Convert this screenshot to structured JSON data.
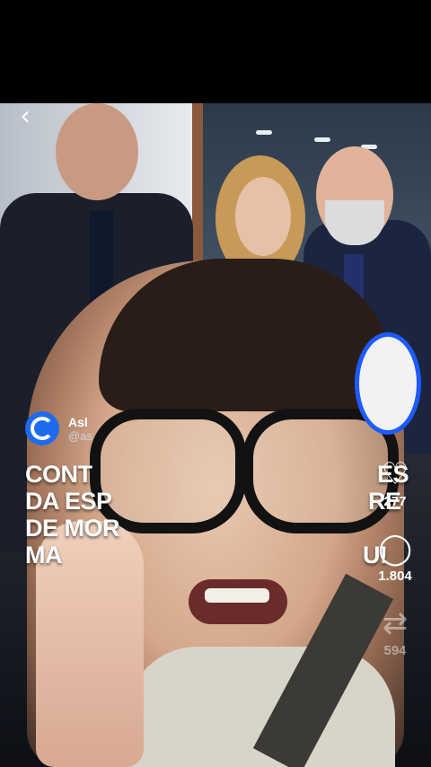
{
  "nav": {
    "back_icon": "chevron-left-icon",
    "back_glyph": "‹"
  },
  "post": {
    "author_name": "Asl",
    "author_handle": "@as",
    "headline_lines": [
      "CONT",
      "DA ESP",
      "DE MOR",
      "MA"
    ],
    "headline_fragments": [
      "ES",
      "RE",
      "U!"
    ]
  },
  "actions": {
    "like": {
      "icon": "heart-icon",
      "glyph": "♡",
      "count": "277"
    },
    "comment": {
      "icon": "comment-icon",
      "glyph": "◯",
      "count": "1.804"
    },
    "repost": {
      "icon": "repost-icon",
      "glyph": "⇄",
      "count": "594"
    }
  },
  "colors": {
    "accent_blue": "#1d5bff",
    "avatar_blue": "#1e6bf0",
    "background": "#000000"
  }
}
